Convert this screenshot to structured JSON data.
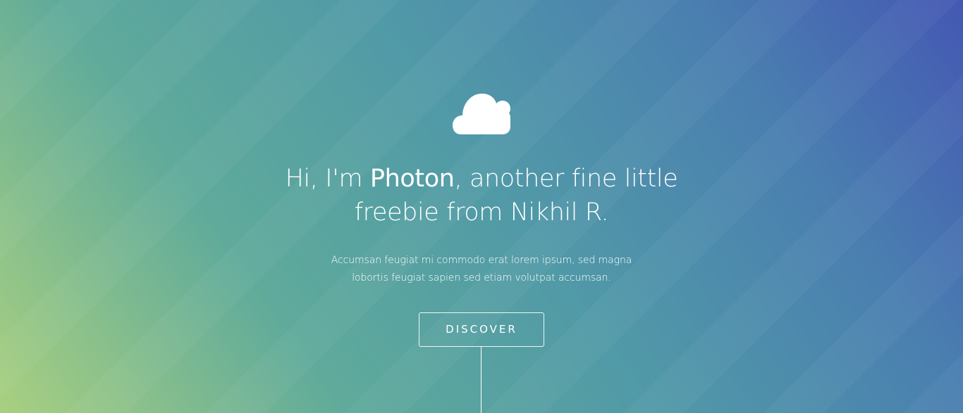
{
  "banner": {
    "heading_prefix": "Hi, I'm ",
    "heading_brand": "Photon",
    "heading_suffix": ", another fine little freebie from Nikhil R.",
    "subtext": "Accumsan feugiat mi commodo erat lorem ipsum, sed magna lobortis feugiat sapien sed etiam volutpat accumsan.",
    "button_label": "DISCOVER",
    "icon": "cloud-icon"
  },
  "colors": {
    "gradient_start": "#a9d080",
    "gradient_mid": "#519aa7",
    "gradient_end": "#4458b3",
    "text": "#ffffff"
  }
}
